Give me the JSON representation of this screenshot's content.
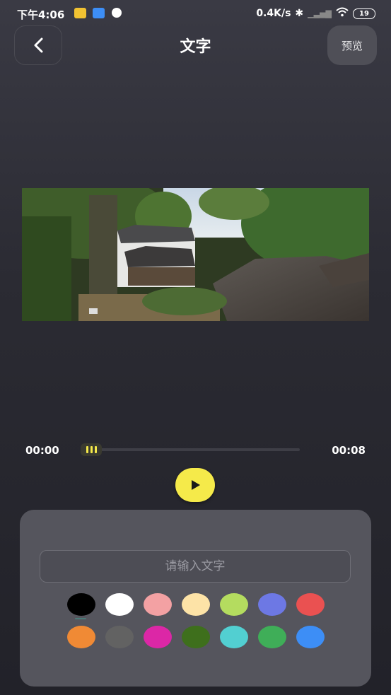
{
  "status_bar": {
    "time": "下午4:06",
    "network_speed": "0.4K/s",
    "battery": "19"
  },
  "header": {
    "title": "文字",
    "preview_label": "预览"
  },
  "player": {
    "current_time": "00:00",
    "total_time": "00:08",
    "progress": 0
  },
  "text_panel": {
    "input_placeholder": "请输入文字",
    "input_value": "",
    "selected_color": "#000000",
    "colors": [
      "#000000",
      "#ffffff",
      "#f3a1a3",
      "#fde3a7",
      "#b4dc5f",
      "#6d78e4",
      "#ea5151",
      "#f08a35",
      "#626262",
      "#dc27a6",
      "#3e6f1c",
      "#52cfd1",
      "#3fae58",
      "#3d8ef6"
    ]
  }
}
